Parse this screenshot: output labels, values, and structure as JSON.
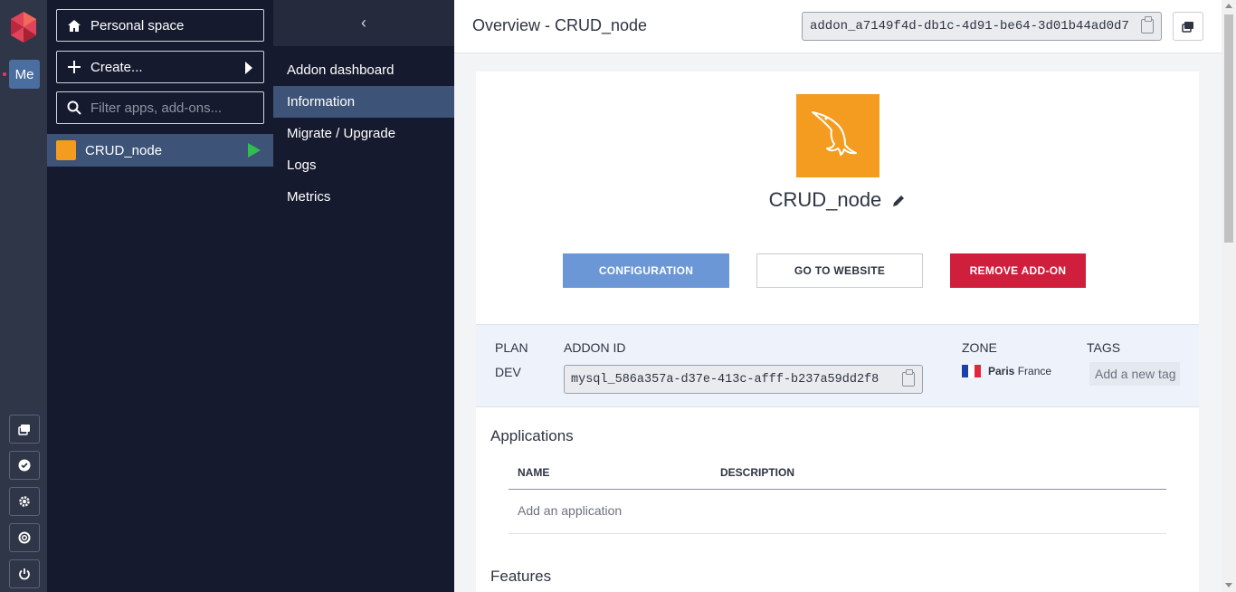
{
  "rail": {
    "me_label": "Me",
    "icons": [
      "changelog-icon",
      "status-icon",
      "settings-icon",
      "help-icon",
      "logout-icon"
    ]
  },
  "apps_sidebar": {
    "personal_space": "Personal space",
    "create": "Create...",
    "filter_placeholder": "Filter apps, add-ons...",
    "app_name": "CRUD_node"
  },
  "addon_menu": {
    "collapse_glyph": "‹",
    "items": [
      "Addon dashboard",
      "Information",
      "Migrate / Upgrade",
      "Logs",
      "Metrics"
    ],
    "active": "Information"
  },
  "header": {
    "title": "Overview - CRUD_node",
    "addon_id": "addon_a7149f4d-db1c-4d91-be64-3d01b44ad0d7"
  },
  "addon": {
    "name": "CRUD_node",
    "config_label": "CONFIGURATION",
    "website_label": "GO TO WEBSITE",
    "remove_label": "REMOVE ADD-ON"
  },
  "info": {
    "plan_label": "PLAN",
    "plan_value": "DEV",
    "addon_id_label": "ADDON ID",
    "addon_id_value": "mysql_586a357a-d37e-413c-afff-b237a59dd2f8",
    "zone_label": "ZONE",
    "zone_city": "Paris",
    "zone_country": "France",
    "tags_label": "TAGS",
    "tags_placeholder": "Add a new tag"
  },
  "applications": {
    "title": "Applications",
    "col_name": "NAME",
    "col_description": "DESCRIPTION",
    "add_label": "Add an application"
  },
  "features": {
    "title": "Features"
  },
  "colors": {
    "accent": "#3d5478",
    "mysql_orange": "#f39c1f",
    "danger": "#cf1f3c",
    "primary": "#6b97d6",
    "running_green": "#2fbf4f"
  }
}
